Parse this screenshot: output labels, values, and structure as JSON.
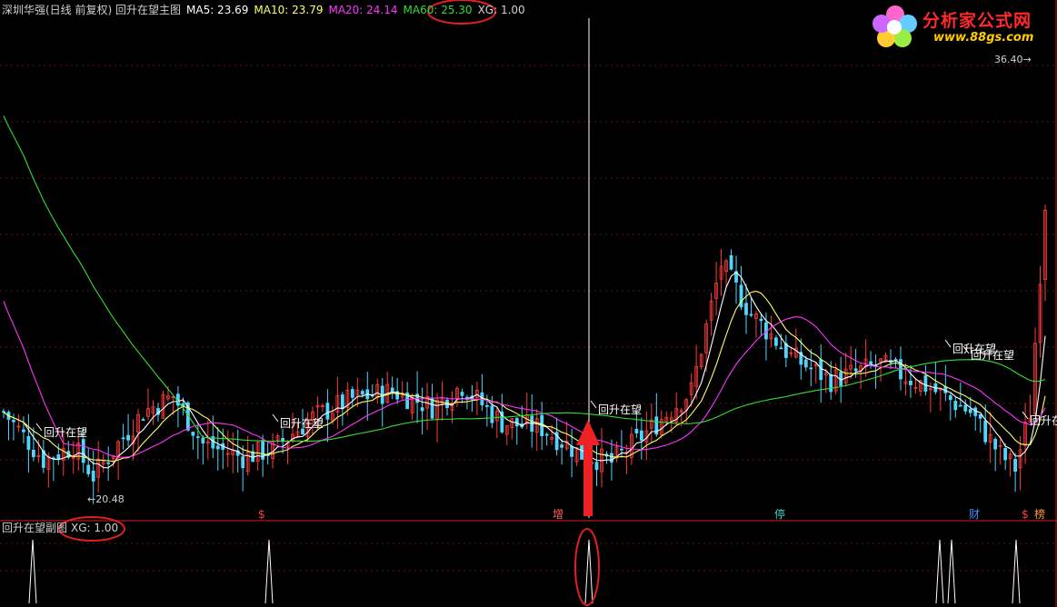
{
  "main_header": {
    "title": "深圳华强(日线 前复权) 回升在望主图",
    "ma5": "MA5: 23.69",
    "ma10": "MA10: 23.79",
    "ma20": "MA20: 24.14",
    "ma60": "MA60: 25.30",
    "xg": "XG: 1.00"
  },
  "sub_header": {
    "title": "回升在望副图",
    "xg": "XG: 1.00"
  },
  "logo": {
    "title": "分析家公式网",
    "url": "www.88gs.com"
  },
  "colors": {
    "background": "#000000",
    "frame": "#b01818",
    "grid": "#7a1a1a",
    "up": "#ff3b3b",
    "down": "#4fd6ff",
    "ma5": "#ffffff",
    "ma10": "#ffff66",
    "ma20": "#ff33ff",
    "ma60": "#33dd33",
    "annotation": "#e03030"
  },
  "chart_data": [
    {
      "type": "line",
      "title": "深圳华强(日线 前复权) 回升在望主图",
      "price_high_label": "36.40",
      "price_low_label": "20.48",
      "ylim": [
        19.6,
        38.2
      ],
      "series": [
        {
          "name": "MA5",
          "last": 23.69
        },
        {
          "name": "MA10",
          "last": 23.79
        },
        {
          "name": "MA20",
          "last": 24.14
        },
        {
          "name": "MA60",
          "last": 25.3
        }
      ],
      "signal_label": "回升在望",
      "event_markers": [
        "增",
        "停",
        "财",
        "榜"
      ]
    },
    {
      "type": "line",
      "title": "回升在望副图",
      "series": [
        {
          "name": "XG",
          "last": 1.0
        }
      ]
    }
  ]
}
